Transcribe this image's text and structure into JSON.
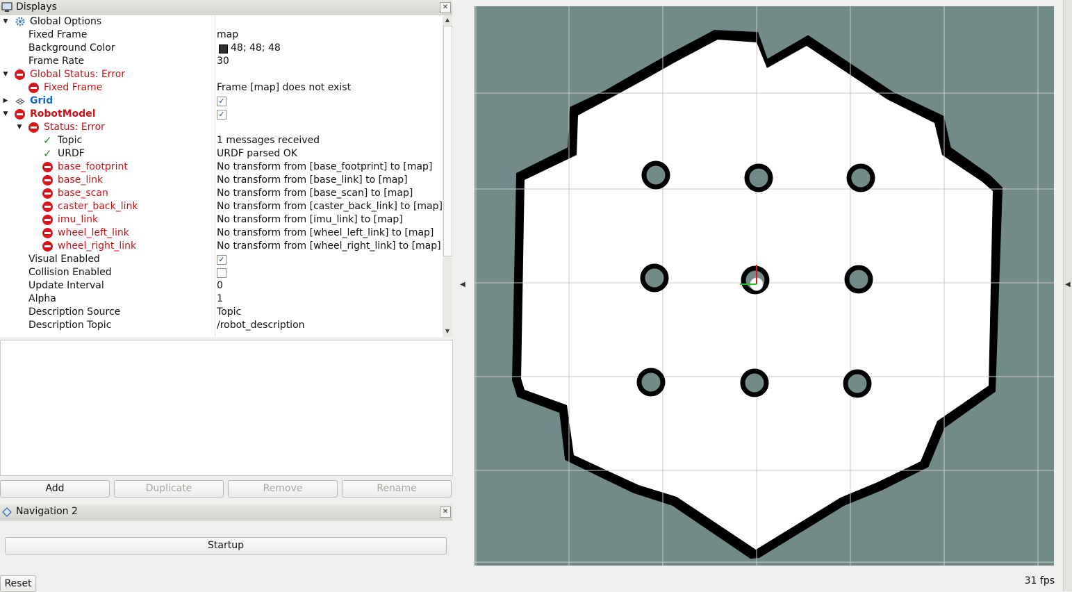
{
  "displays": {
    "title": "Displays",
    "rows": [
      {
        "label": "Global Options",
        "value": ""
      },
      {
        "label": "Fixed Frame",
        "value": "map"
      },
      {
        "label": "Background Color",
        "value": "48; 48; 48"
      },
      {
        "label": "Frame Rate",
        "value": "30"
      },
      {
        "label": "Global Status: Error",
        "value": ""
      },
      {
        "label": "Fixed Frame",
        "value": "Frame [map] does not exist"
      },
      {
        "label": "Grid",
        "value": ""
      },
      {
        "label": "RobotModel",
        "value": ""
      },
      {
        "label": "Status: Error",
        "value": ""
      },
      {
        "label": "Topic",
        "value": "1 messages received"
      },
      {
        "label": "URDF",
        "value": "URDF parsed OK"
      },
      {
        "label": "base_footprint",
        "value": "No transform from [base_footprint] to [map]"
      },
      {
        "label": "base_link",
        "value": "No transform from [base_link] to [map]"
      },
      {
        "label": "base_scan",
        "value": "No transform from [base_scan] to [map]"
      },
      {
        "label": "caster_back_link",
        "value": "No transform from [caster_back_link] to [map]"
      },
      {
        "label": "imu_link",
        "value": "No transform from [imu_link] to [map]"
      },
      {
        "label": "wheel_left_link",
        "value": "No transform from [wheel_left_link] to [map]"
      },
      {
        "label": "wheel_right_link",
        "value": "No transform from [wheel_right_link] to [map]"
      },
      {
        "label": "Visual Enabled",
        "value": ""
      },
      {
        "label": "Collision Enabled",
        "value": ""
      },
      {
        "label": "Update Interval",
        "value": "0"
      },
      {
        "label": "Alpha",
        "value": "1"
      },
      {
        "label": "Description Source",
        "value": "Topic"
      },
      {
        "label": "Description Topic",
        "value": "/robot_description"
      }
    ],
    "checkboxes": {
      "grid": true,
      "robotmodel": true,
      "visual_enabled": true,
      "collision_enabled": false
    }
  },
  "buttons": {
    "add": "Add",
    "duplicate": "Duplicate",
    "remove": "Remove",
    "rename": "Rename"
  },
  "navigation": {
    "title": "Navigation 2",
    "startup": "Startup"
  },
  "footer": {
    "reset": "Reset",
    "fps": "31 fps"
  },
  "colors": {
    "error": "#c4141a",
    "viewport_bg": "#728b89",
    "map_free": "#ffffff",
    "map_occupied": "#000000"
  }
}
